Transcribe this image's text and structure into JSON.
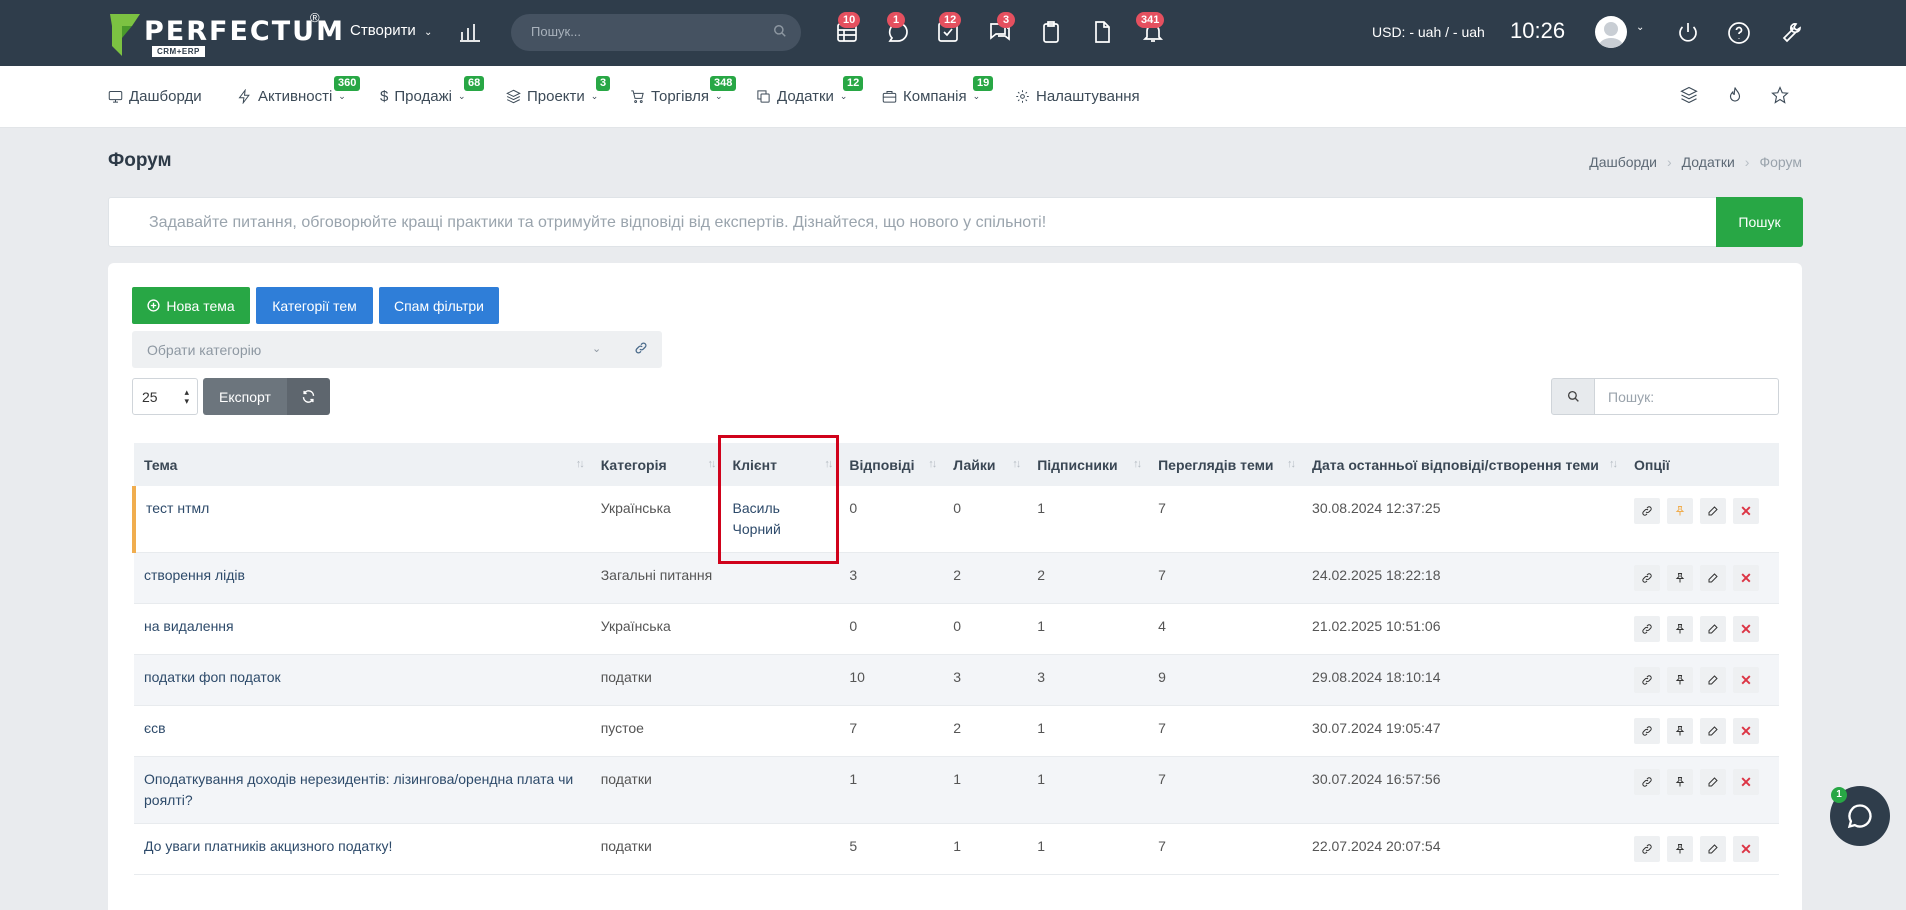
{
  "header": {
    "logo_text": "PERFECTUM",
    "logo_reg": "®",
    "logo_sub": "CRM+ERP",
    "create_label": "Створити",
    "search_placeholder": "Пошук...",
    "badges": [
      "10",
      "1",
      "12",
      "3",
      "341"
    ],
    "currency": "USD: - uah / - uah",
    "time": "10:26"
  },
  "menu": {
    "items": [
      {
        "label": "Дашборди",
        "badge": ""
      },
      {
        "label": "Активності",
        "badge": "360"
      },
      {
        "label": "Продажі",
        "badge": "68"
      },
      {
        "label": "Проекти",
        "badge": "3"
      },
      {
        "label": "Торгівля",
        "badge": "348"
      },
      {
        "label": "Додатки",
        "badge": "12"
      },
      {
        "label": "Компанія",
        "badge": "19"
      },
      {
        "label": "Налаштування",
        "badge": ""
      }
    ]
  },
  "page": {
    "title": "Форум",
    "breadcrumb": [
      "Дашборди",
      "Додатки",
      "Форум"
    ]
  },
  "forum_search": {
    "placeholder": "Задавайте питання, обговорюйте кращі практики та отримуйте відповіді від експертів. Дізнайтеся, що нового у спільноті!",
    "button": "Пошук"
  },
  "toolbar": {
    "new_topic": "Нова тема",
    "categories": "Категорії тем",
    "spam": "Спам фільтри",
    "category_placeholder": "Обрати категорію",
    "per_page": "25",
    "export": "Експорт",
    "table_search_placeholder": "Пошук:"
  },
  "table": {
    "columns": [
      "Тема",
      "Категорія",
      "Клієнт",
      "Відповіді",
      "Лайки",
      "Підписники",
      "Переглядів теми",
      "Дата останньої відповіді/створення теми",
      "Опції"
    ],
    "rows": [
      {
        "topic": "тест нтмл",
        "category": "Українська",
        "client": "Василь Чорний",
        "replies": "0",
        "likes": "0",
        "subscribers": "1",
        "views": "7",
        "date": "30.08.2024 12:37:25"
      },
      {
        "topic": "створення лідів",
        "category": "Загальні питання",
        "client": "",
        "replies": "3",
        "likes": "2",
        "subscribers": "2",
        "views": "7",
        "date": "24.02.2025 18:22:18"
      },
      {
        "topic": "на видалення",
        "category": "Українська",
        "client": "",
        "replies": "0",
        "likes": "0",
        "subscribers": "1",
        "views": "4",
        "date": "21.02.2025 10:51:06"
      },
      {
        "topic": "податки фоп податок",
        "category": "податки",
        "client": "",
        "replies": "10",
        "likes": "3",
        "subscribers": "3",
        "views": "9",
        "date": "29.08.2024 18:10:14"
      },
      {
        "topic": "єсв",
        "category": "пустое",
        "client": "",
        "replies": "7",
        "likes": "2",
        "subscribers": "1",
        "views": "7",
        "date": "30.07.2024 19:05:47"
      },
      {
        "topic": "Оподаткування доходів нерезидентів: лізингова/орендна плата чи роялті?",
        "category": "податки",
        "client": "",
        "replies": "1",
        "likes": "1",
        "subscribers": "1",
        "views": "7",
        "date": "30.07.2024 16:57:56"
      },
      {
        "topic": "До уваги платників акцизного податку!",
        "category": "податки",
        "client": "",
        "replies": "5",
        "likes": "1",
        "subscribers": "1",
        "views": "7",
        "date": "22.07.2024 20:07:54"
      }
    ]
  },
  "chat": {
    "badge": "1"
  },
  "colors": {
    "topbar": "#2f3d4b",
    "green": "#28a745",
    "blue": "#2f7ed8",
    "badge_red": "#e5505f",
    "highlight": "#d0021b"
  }
}
